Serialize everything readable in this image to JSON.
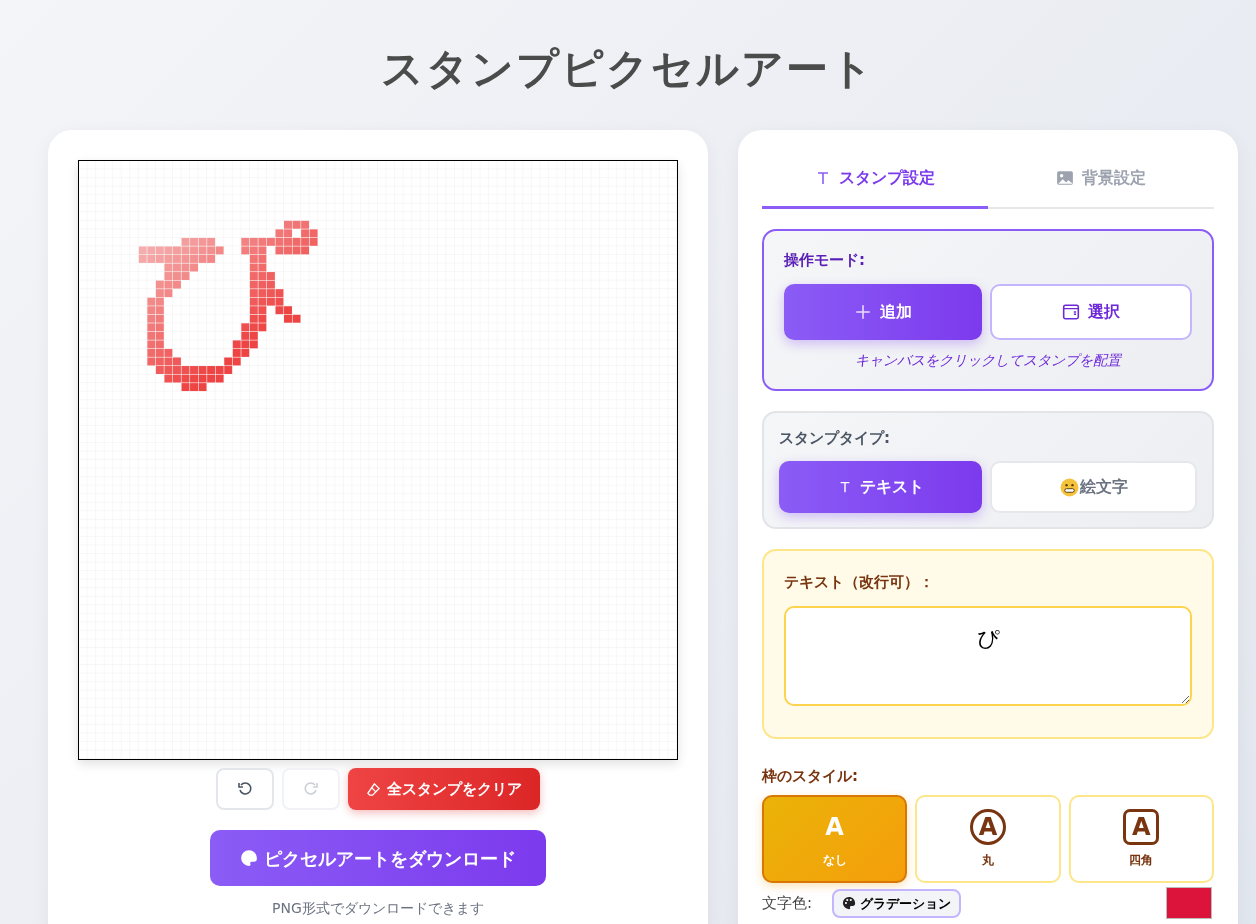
{
  "title": "スタンプピクセルアート",
  "history_buttons": [
    {
      "kind": "undo",
      "disabled": false
    },
    {
      "kind": "redo",
      "disabled": true
    }
  ],
  "clear_button": "全スタンプをクリア",
  "download_button": "ピクセルアートをダウンロード",
  "download_note": "PNG形式でダウンロードできます",
  "tabs": [
    {
      "label": "スタンプ設定",
      "kind": "text",
      "selected": true
    },
    {
      "label": "背景設定",
      "kind": "image",
      "selected": false
    }
  ],
  "mode": {
    "label": "操作モード:",
    "hint": "キャンバスをクリックしてスタンプを配置",
    "options": [
      {
        "label": "追加",
        "kind": "plus",
        "selected": true
      },
      {
        "label": "選択",
        "kind": "window",
        "selected": false
      }
    ]
  },
  "stamp_type": {
    "label": "スタンプタイプ:",
    "options": [
      {
        "label": "テキスト",
        "kind": "text",
        "selected": true
      },
      {
        "label": "絵文字",
        "kind": "emoji",
        "selected": false
      }
    ]
  },
  "text_input": {
    "label": "テキスト（改行可）：",
    "value": "ぴ"
  },
  "frame_style": {
    "label": "枠のスタイル:",
    "options": [
      {
        "label": "なし",
        "sample": "A",
        "kind": "none",
        "selected": true
      },
      {
        "label": "丸",
        "sample": "A",
        "kind": "circle",
        "selected": false
      },
      {
        "label": "四角",
        "sample": "A",
        "kind": "square",
        "selected": false
      }
    ]
  },
  "text_color": {
    "label": "文字色:",
    "gradient_button": "グラデーション",
    "color": "#dc143c"
  }
}
